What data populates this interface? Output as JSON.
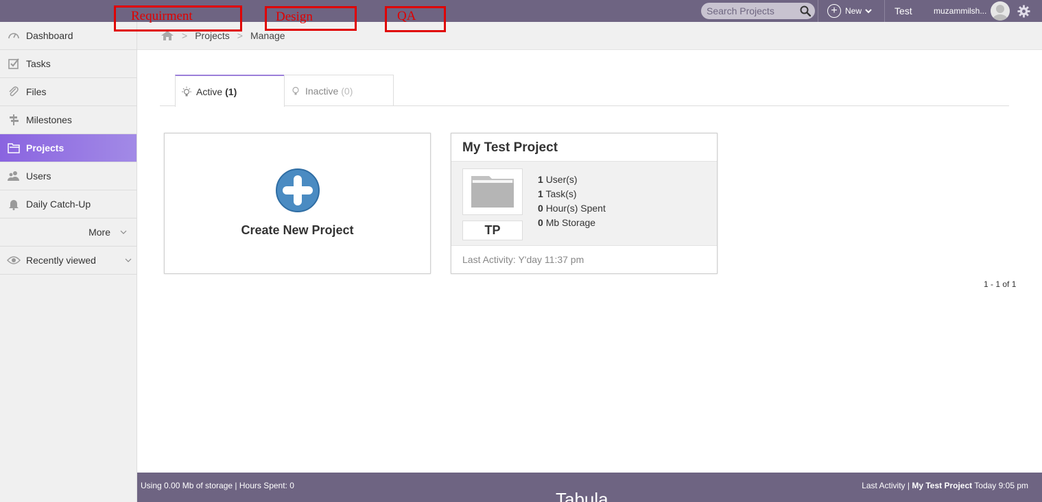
{
  "annotations": [
    "Requirment",
    "Design",
    "QA"
  ],
  "topbar": {
    "search_placeholder": "Search Projects",
    "new_label": "New",
    "test_label": "Test",
    "username": "muzammilsh..."
  },
  "sidebar": {
    "items": [
      {
        "label": "Dashboard",
        "icon": "speedometer-icon"
      },
      {
        "label": "Tasks",
        "icon": "checklist-icon"
      },
      {
        "label": "Files",
        "icon": "paperclip-icon"
      },
      {
        "label": "Milestones",
        "icon": "signpost-icon"
      },
      {
        "label": "Projects",
        "icon": "folder-icon",
        "active": true
      },
      {
        "label": "Users",
        "icon": "users-icon"
      },
      {
        "label": "Daily Catch-Up",
        "icon": "bell-icon"
      }
    ],
    "more_label": "More",
    "recent_label": "Recently viewed"
  },
  "breadcrumb": {
    "items": [
      "Projects",
      "Manage"
    ]
  },
  "tabs": {
    "active_label": "Active",
    "active_count": "(1)",
    "inactive_label": "Inactive",
    "inactive_count": "(0)"
  },
  "create_card": {
    "label": "Create New Project"
  },
  "project": {
    "title": "My Test Project",
    "initials": "TP",
    "users_count": "1",
    "users_label": "User(s)",
    "tasks_count": "1",
    "tasks_label": "Task(s)",
    "hours_count": "0",
    "hours_label": "Hour(s) Spent",
    "storage_count": "0",
    "storage_label": "Mb Storage",
    "last_activity": "Last Activity: Y'day 11:37 pm"
  },
  "pager": "1 - 1 of 1",
  "footer": {
    "left": "Using 0.00 Mb of storage | Hours Spent: 0",
    "right_prefix": "Last Activity |",
    "right_project": "My Test Project",
    "right_time": "Today 9:05 pm",
    "brand": "Tabula"
  },
  "colors": {
    "topbar": "#6e6482",
    "accent": "#8a64e0",
    "annotation": "#e00000",
    "create_icon": "#4a8bc2"
  }
}
